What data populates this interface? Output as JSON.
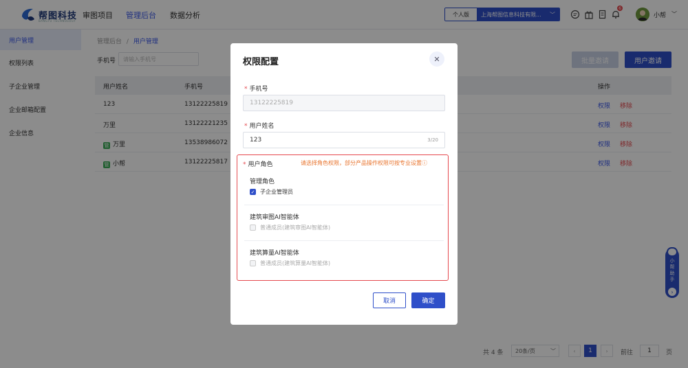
{
  "header": {
    "logo_text": "帮图科技",
    "logo_sub": "BANGTU TECHNOLOGY",
    "nav": [
      "审图项目",
      "管理后台",
      "数据分析"
    ],
    "active_nav": "管理后台",
    "version_label": "个人版",
    "company": "上海帮图信息科技有限...",
    "notification_count": "6",
    "username": "小帮",
    "icons": [
      "chat-icon",
      "gift-icon",
      "document-icon",
      "bell-icon"
    ]
  },
  "sidebar": {
    "items": [
      {
        "label": "用户管理",
        "active": true
      },
      {
        "label": "权限列表",
        "active": false
      },
      {
        "label": "子企业管理",
        "active": false
      },
      {
        "label": "企业邮箱配置",
        "active": false
      },
      {
        "label": "企业信息",
        "active": false
      }
    ]
  },
  "breadcrumb": {
    "root": "管理后台",
    "separator": "/",
    "current": "用户管理"
  },
  "filter": {
    "phone_label": "手机号",
    "phone_placeholder": "请输入手机号"
  },
  "actions": {
    "batch_invite": "批量邀请",
    "invite": "用户邀请"
  },
  "table": {
    "headers": {
      "name": "用户姓名",
      "phone": "手机号",
      "ops": "操作"
    },
    "rows": [
      {
        "name": "123",
        "phone": "13122225819",
        "tag": false
      },
      {
        "name": "万里",
        "phone": "13122221235",
        "tag": false
      },
      {
        "name": "万里",
        "phone": "13538986072",
        "tag": true
      },
      {
        "name": "小帮",
        "phone": "13122225817",
        "tag": true
      }
    ],
    "tag_label": "管",
    "op_permission": "权限",
    "op_remove": "移除"
  },
  "pagination": {
    "total": "共 4 条",
    "page_size": "20条/页",
    "current": "1",
    "goto_label": "前往",
    "goto_value": "1",
    "page_suffix": "页"
  },
  "helper": {
    "text": [
      "小",
      "帮",
      "助",
      "手"
    ]
  },
  "modal": {
    "title": "权限配置",
    "phone_label": "手机号",
    "phone_value": "13122225819",
    "name_label": "用户姓名",
    "name_value": "123",
    "name_count": "3/20",
    "role_label": "用户角色",
    "role_hint": "请选择角色权限，部分产品操作权限可按专业设置ⓘ",
    "groups": [
      {
        "title": "管理角色",
        "option": "子企业管理员",
        "checked": true,
        "disabled": false
      },
      {
        "title": "建筑审图AI智能体",
        "option": "普通成员(建筑审图AI智能体)",
        "checked": false,
        "disabled": true
      },
      {
        "title": "建筑算量AI智能体",
        "option": "普通成员(建筑算量AI智能体)",
        "checked": false,
        "disabled": true
      }
    ],
    "cancel": "取消",
    "confirm": "确定"
  }
}
